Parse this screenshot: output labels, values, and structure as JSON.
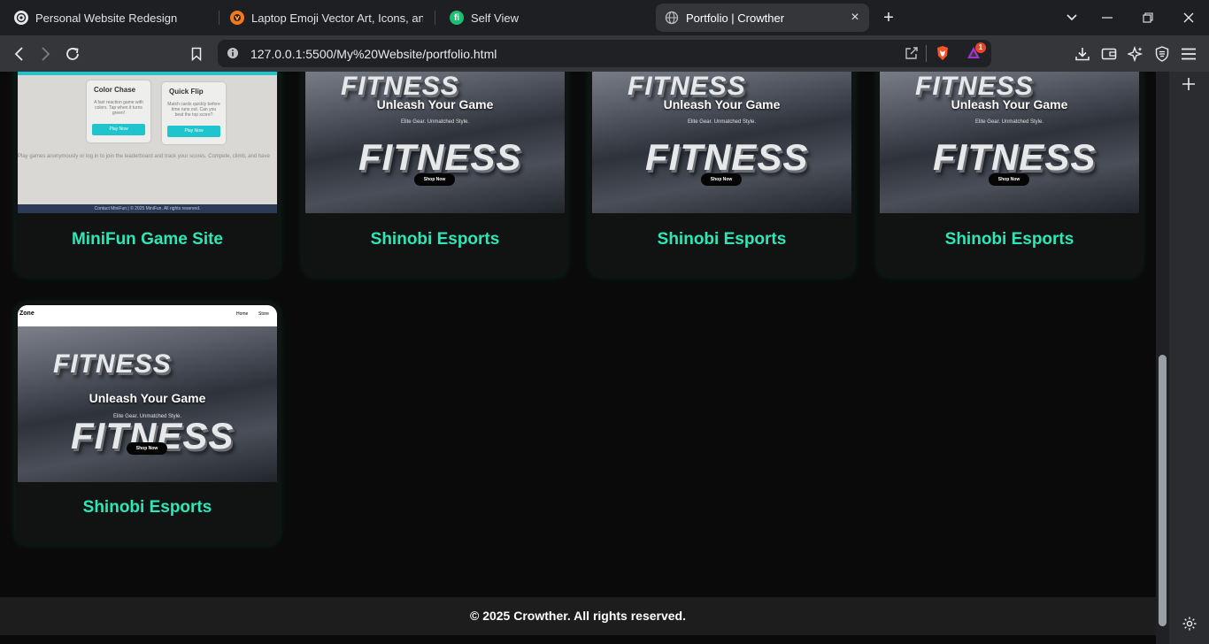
{
  "browser": {
    "tabs": [
      {
        "title": "Personal Website Redesign",
        "icon": "openai-icon"
      },
      {
        "title": "Laptop Emoji Vector Art, Icons, and G",
        "icon": "vecteezy-icon"
      },
      {
        "title": "Self View",
        "icon": "fiverr-icon",
        "icon_text": "fi"
      },
      {
        "title": "Portfolio | Crowther",
        "icon": "globe-icon",
        "active": true
      }
    ],
    "url": "127.0.0.1:5500/My%20Website/portfolio.html",
    "shield_badge": "1"
  },
  "portfolio": {
    "cards": [
      {
        "title": "MiniFun Game Site",
        "preview": {
          "games": [
            {
              "name": "Color Chase",
              "desc": "A fast reaction game with colors. Tap when it turns green!",
              "button": "Play Now"
            },
            {
              "name": "Quick Flip",
              "desc": "Match cards quickly before time runs out. Can you beat the top score?",
              "button": "Play Now"
            }
          ],
          "blurb": "Play games anonymously or log in to join the leaderboard and track your scores. Compete, climb, and have",
          "footer": "Contact MiniFun | © 2025 MiniFun. All rights reserved."
        }
      },
      {
        "title": "Shinobi Esports",
        "preview": {
          "headline": "Unleash Your Game",
          "tagline": "Elite Gear. Unmatched Style.",
          "button": "Shop Now",
          "backdrop_word": "FITNESS",
          "backdrop_word_2": "FITNESS"
        }
      },
      {
        "title": "Shinobi Esports",
        "preview": {
          "headline": "Unleash Your Game",
          "tagline": "Elite Gear. Unmatched Style.",
          "button": "Shop Now",
          "backdrop_word": "FITNESS",
          "backdrop_word_2": "FITNESS"
        }
      },
      {
        "title": "Shinobi Esports",
        "preview": {
          "headline": "Unleash Your Game",
          "tagline": "Elite Gear. Unmatched Style.",
          "button": "Shop Now",
          "backdrop_word": "FITNESS",
          "backdrop_word_2": "FITNESS"
        }
      },
      {
        "title": "Shinobi Esports",
        "preview": {
          "nav_brand": "Zone",
          "nav_links": [
            "Home",
            "Store"
          ],
          "headline": "Unleash Your Game",
          "tagline": "Elite Gear. Unmatched Style.",
          "button": "Shop Now",
          "backdrop_word": "FITNESS",
          "backdrop_word_2": "FITNESS"
        }
      }
    ]
  },
  "footer": {
    "text": "© 2025 Crowther. All rights reserved."
  },
  "colors": {
    "accent": "#2ee6b6",
    "page_bg": "#0a0a0a",
    "card_bg": "#111313",
    "footer_bg": "#1d1d1d"
  }
}
